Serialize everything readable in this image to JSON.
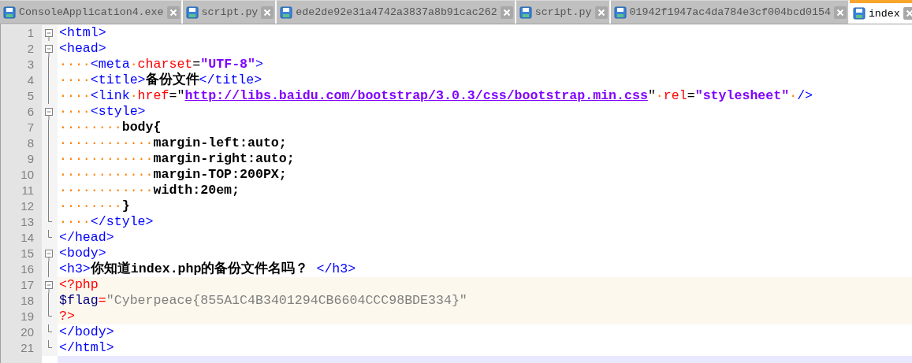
{
  "tabs": [
    {
      "label": "ConsoleApplication4.exe",
      "selected": false
    },
    {
      "label": "script.py",
      "selected": false
    },
    {
      "label": "ede2de92e31a4742a3837a8b91cac262",
      "selected": false
    },
    {
      "label": "script.py",
      "selected": false
    },
    {
      "label": "01942f1947ac4da784e3cf004bcd0154",
      "selected": false
    },
    {
      "label": "index",
      "selected": true
    }
  ],
  "lines": [
    {
      "number": "1",
      "fold_start": true,
      "fold_end": false,
      "highlight": false,
      "current": false,
      "tokens": [
        {
          "kind": "tag",
          "text": "<html>"
        }
      ]
    },
    {
      "number": "2",
      "fold_start": true,
      "fold_end": false,
      "highlight": false,
      "current": false,
      "tokens": [
        {
          "kind": "tag",
          "text": "<head>"
        }
      ]
    },
    {
      "number": "3",
      "fold_start": false,
      "fold_end": false,
      "highlight": false,
      "current": false,
      "tokens": [
        {
          "kind": "ws",
          "text": "····"
        },
        {
          "kind": "tag",
          "text": "<meta"
        },
        {
          "kind": "ws",
          "text": "·"
        },
        {
          "kind": "attr",
          "text": "charset"
        },
        {
          "kind": "plain",
          "text": "="
        },
        {
          "kind": "value",
          "text": "\"UTF-8\""
        },
        {
          "kind": "tag",
          "text": ">"
        }
      ]
    },
    {
      "number": "4",
      "fold_start": false,
      "fold_end": false,
      "highlight": false,
      "current": false,
      "tokens": [
        {
          "kind": "ws",
          "text": "····"
        },
        {
          "kind": "tag",
          "text": "<title>"
        },
        {
          "kind": "text",
          "text": "备份文件"
        },
        {
          "kind": "tag",
          "text": "</title>"
        }
      ]
    },
    {
      "number": "5",
      "fold_start": false,
      "fold_end": false,
      "highlight": false,
      "current": false,
      "tokens": [
        {
          "kind": "ws",
          "text": "····"
        },
        {
          "kind": "tag",
          "text": "<link"
        },
        {
          "kind": "ws",
          "text": "·"
        },
        {
          "kind": "attr",
          "text": "href"
        },
        {
          "kind": "plain",
          "text": "=\""
        },
        {
          "kind": "url",
          "text": "http://libs.baidu.com/bootstrap/3.0.3/css/bootstrap.min.css"
        },
        {
          "kind": "plain",
          "text": "\""
        },
        {
          "kind": "ws",
          "text": "·"
        },
        {
          "kind": "attr",
          "text": "rel"
        },
        {
          "kind": "plain",
          "text": "="
        },
        {
          "kind": "value",
          "text": "\"stylesheet\""
        },
        {
          "kind": "ws",
          "text": "·"
        },
        {
          "kind": "tag",
          "text": "/>"
        }
      ]
    },
    {
      "number": "6",
      "fold_start": true,
      "fold_end": false,
      "highlight": false,
      "current": false,
      "tokens": [
        {
          "kind": "ws",
          "text": "····"
        },
        {
          "kind": "tag",
          "text": "<style>"
        }
      ]
    },
    {
      "number": "7",
      "fold_start": false,
      "fold_end": false,
      "highlight": false,
      "current": false,
      "tokens": [
        {
          "kind": "ws",
          "text": "········"
        },
        {
          "kind": "text",
          "text": "body{"
        }
      ]
    },
    {
      "number": "8",
      "fold_start": false,
      "fold_end": false,
      "highlight": false,
      "current": false,
      "tokens": [
        {
          "kind": "ws",
          "text": "············"
        },
        {
          "kind": "text",
          "text": "margin-left:auto;"
        }
      ]
    },
    {
      "number": "9",
      "fold_start": false,
      "fold_end": false,
      "highlight": false,
      "current": false,
      "tokens": [
        {
          "kind": "ws",
          "text": "············"
        },
        {
          "kind": "text",
          "text": "margin-right:auto;"
        }
      ]
    },
    {
      "number": "10",
      "fold_start": false,
      "fold_end": false,
      "highlight": false,
      "current": false,
      "tokens": [
        {
          "kind": "ws",
          "text": "············"
        },
        {
          "kind": "text",
          "text": "margin-TOP:200PX;"
        }
      ]
    },
    {
      "number": "11",
      "fold_start": false,
      "fold_end": false,
      "highlight": false,
      "current": false,
      "tokens": [
        {
          "kind": "ws",
          "text": "············"
        },
        {
          "kind": "text",
          "text": "width:20em;"
        }
      ]
    },
    {
      "number": "12",
      "fold_start": false,
      "fold_end": false,
      "highlight": false,
      "current": false,
      "tokens": [
        {
          "kind": "ws",
          "text": "········"
        },
        {
          "kind": "text",
          "text": "}"
        }
      ]
    },
    {
      "number": "13",
      "fold_start": false,
      "fold_end": true,
      "highlight": false,
      "current": false,
      "tokens": [
        {
          "kind": "ws",
          "text": "····"
        },
        {
          "kind": "tag",
          "text": "</style>"
        }
      ]
    },
    {
      "number": "14",
      "fold_start": false,
      "fold_end": true,
      "highlight": false,
      "current": false,
      "tokens": [
        {
          "kind": "tag",
          "text": "</head>"
        }
      ]
    },
    {
      "number": "15",
      "fold_start": true,
      "fold_end": false,
      "highlight": false,
      "current": false,
      "tokens": [
        {
          "kind": "tag",
          "text": "<body>"
        }
      ]
    },
    {
      "number": "16",
      "fold_start": false,
      "fold_end": false,
      "highlight": false,
      "current": false,
      "tokens": [
        {
          "kind": "tag",
          "text": "<h3>"
        },
        {
          "kind": "text",
          "text": "你知道index.php的备份文件名吗？"
        },
        {
          "kind": "tag",
          "text": " </h3>"
        }
      ]
    },
    {
      "number": "17",
      "fold_start": true,
      "fold_end": false,
      "highlight": true,
      "current": false,
      "tokens": [
        {
          "kind": "php",
          "text": "<?php"
        }
      ]
    },
    {
      "number": "18",
      "fold_start": false,
      "fold_end": false,
      "highlight": true,
      "current": false,
      "tokens": [
        {
          "kind": "var",
          "text": "$flag"
        },
        {
          "kind": "op",
          "text": "="
        },
        {
          "kind": "string",
          "text": "\"Cyberpeace{855A1C4B3401294CB6604CCC98BDE334}\""
        }
      ]
    },
    {
      "number": "19",
      "fold_start": false,
      "fold_end": true,
      "highlight": true,
      "current": false,
      "tokens": [
        {
          "kind": "php",
          "text": "?>"
        }
      ]
    },
    {
      "number": "20",
      "fold_start": false,
      "fold_end": true,
      "highlight": false,
      "current": false,
      "tokens": [
        {
          "kind": "tag",
          "text": "</body>"
        }
      ]
    },
    {
      "number": "21",
      "fold_start": false,
      "fold_end": true,
      "highlight": false,
      "current": false,
      "tokens": [
        {
          "kind": "tag",
          "text": "</html>"
        }
      ]
    },
    {
      "current": true
    }
  ]
}
